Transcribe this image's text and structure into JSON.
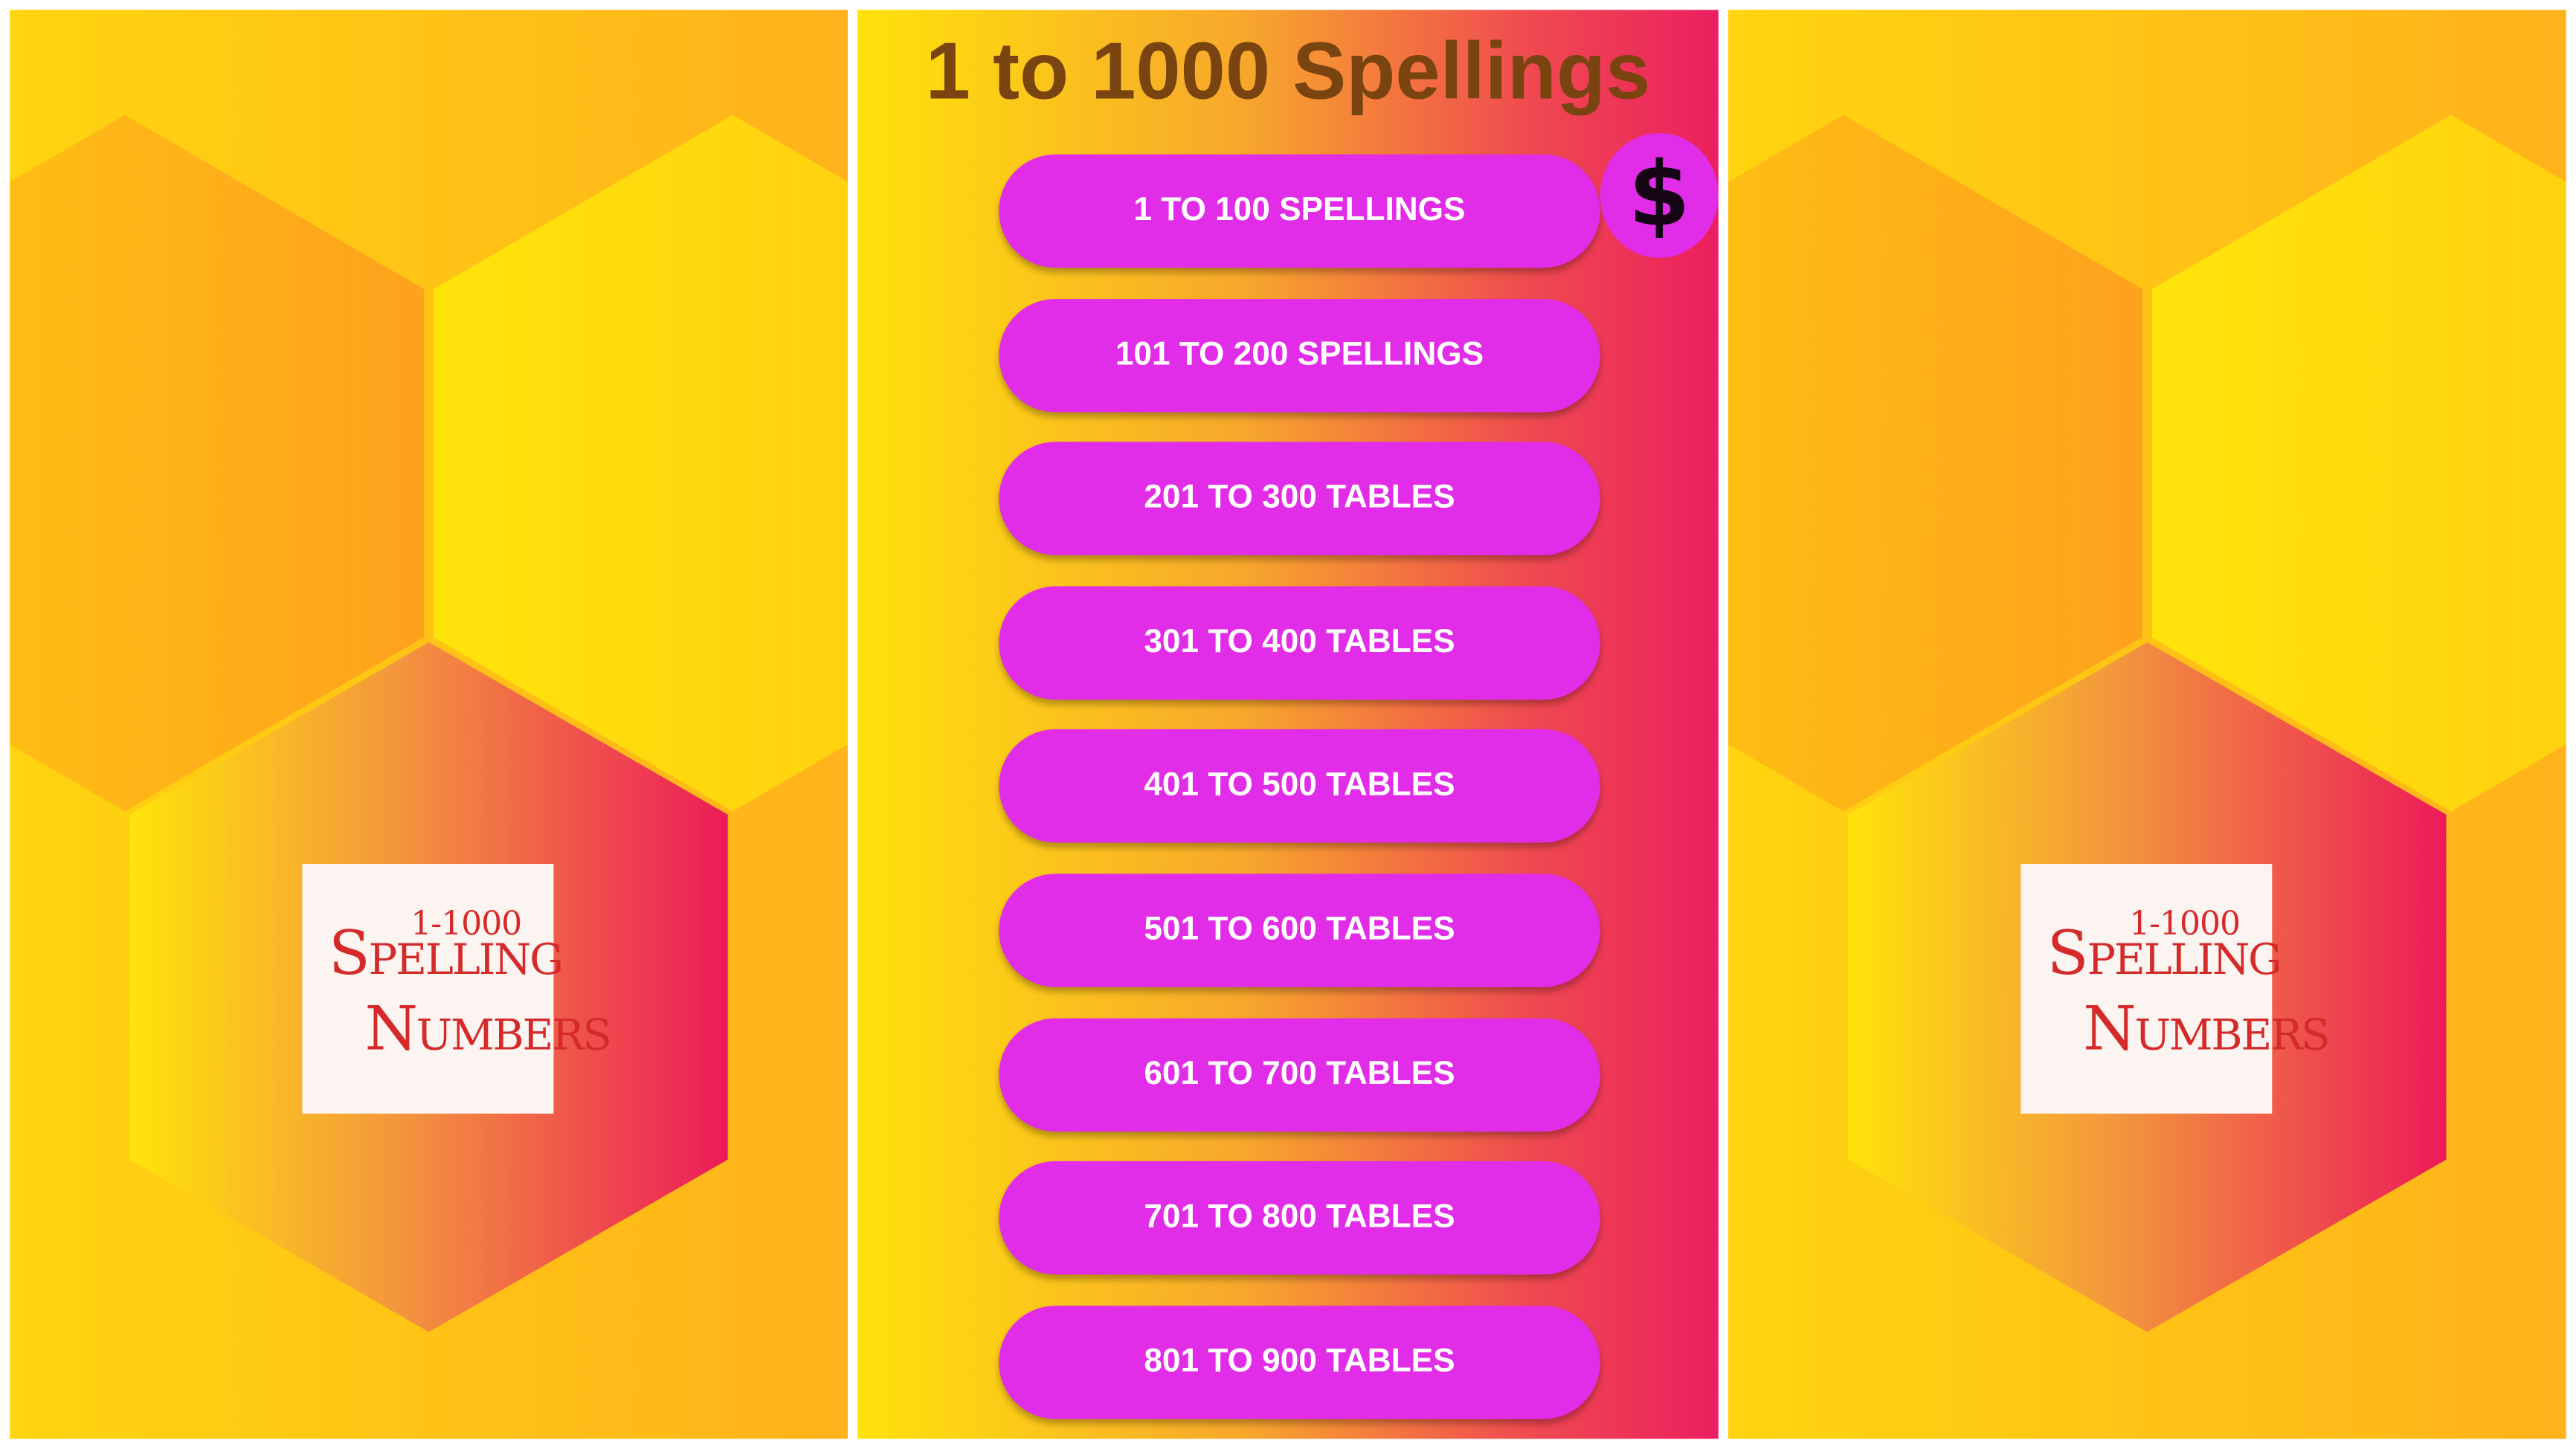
{
  "splash_left": {
    "logo": {
      "range": "1-1000",
      "word1": "Spelling",
      "word2": "Numbers"
    }
  },
  "menu": {
    "title": "1 to 1000 Spellings",
    "buttons": [
      {
        "label": "1 TO 100 SPELLINGS"
      },
      {
        "label": "101 TO 200 SPELLINGS"
      },
      {
        "label": "201 TO 300 TABLES"
      },
      {
        "label": "301 TO 400 TABLES"
      },
      {
        "label": "401 TO 500 TABLES"
      },
      {
        "label": "501 TO 600 TABLES"
      },
      {
        "label": "601 TO 700 TABLES"
      },
      {
        "label": "701 TO 800 TABLES"
      },
      {
        "label": "801 TO 900 TABLES"
      }
    ],
    "donate_symbol": "$"
  },
  "splash_right": {
    "logo": {
      "range": "1-1000",
      "word1": "Spelling",
      "word2": "Numbers"
    }
  },
  "colors": {
    "button": "#e22de8",
    "title": "#7a4410",
    "logo_text": "#d42a2a"
  }
}
